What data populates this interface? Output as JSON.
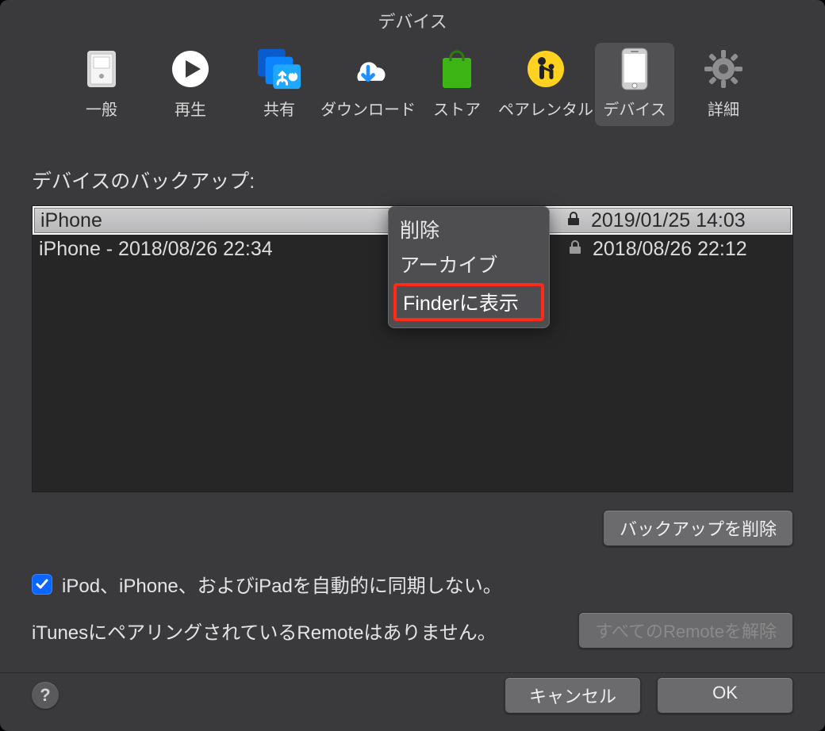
{
  "window": {
    "title": "デバイス"
  },
  "toolbar": {
    "items": [
      {
        "label": "一般"
      },
      {
        "label": "再生"
      },
      {
        "label": "共有"
      },
      {
        "label": "ダウンロード"
      },
      {
        "label": "ストア"
      },
      {
        "label": "ペアレンタル"
      },
      {
        "label": "デバイス"
      },
      {
        "label": "詳細"
      }
    ],
    "selected_index": 6
  },
  "section": {
    "label": "デバイスのバックアップ:"
  },
  "backups": [
    {
      "name": "iPhone",
      "locked": true,
      "date": "2019/01/25 14:03",
      "selected": true
    },
    {
      "name": "iPhone - 2018/08/26 22:34",
      "locked": true,
      "date": "2018/08/26 22:12",
      "selected": false
    }
  ],
  "context_menu": {
    "items": [
      {
        "label": "削除"
      },
      {
        "label": "アーカイブ"
      },
      {
        "label": "Finderに表示",
        "highlighted": true
      }
    ]
  },
  "buttons": {
    "delete_backup": "バックアップを削除",
    "remove_all_remotes": "すべてのRemoteを解除",
    "cancel": "キャンセル",
    "ok": "OK",
    "help": "?"
  },
  "sync": {
    "checked": true,
    "label": "iPod、iPhone、およびiPadを自動的に同期しない。"
  },
  "remote": {
    "status": "iTunesにペアリングされているRemoteはありません。"
  }
}
